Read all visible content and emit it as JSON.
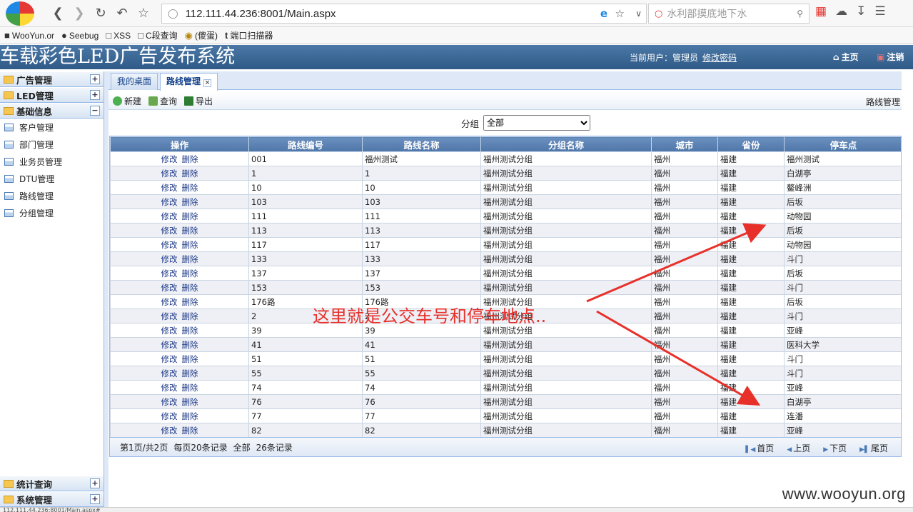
{
  "browser": {
    "url": "112.111.44.236:8001/Main.aspx",
    "search_placeholder": "水利部摸底地下水",
    "bookmarks": [
      "WooYun.or",
      "Seebug",
      "XSS",
      "C段查询",
      "(傻蛋)",
      "端口扫描器"
    ]
  },
  "header": {
    "title": "车载彩色LED广告发布系统",
    "current_user_label": "当前用户：管理员",
    "change_password": "修改密码",
    "home": "主页",
    "logout": "注销"
  },
  "sidebar": {
    "groups": [
      {
        "label": "广告管理",
        "toggle": "+"
      },
      {
        "label": "LED管理",
        "toggle": "+"
      },
      {
        "label": "基础信息",
        "toggle": "−"
      }
    ],
    "items": [
      "客户管理",
      "部门管理",
      "业务员管理",
      "DTU管理",
      "路线管理",
      "分组管理"
    ],
    "bottom_groups": [
      {
        "label": "统计查询",
        "toggle": "+"
      },
      {
        "label": "系统管理",
        "toggle": "+"
      }
    ]
  },
  "tabs": [
    {
      "label": "我的桌面"
    },
    {
      "label": "路线管理",
      "close": "×"
    }
  ],
  "toolbar": {
    "new": "新建",
    "query": "查询",
    "export": "导出",
    "title": "路线管理"
  },
  "filter": {
    "label": "分组",
    "selected": "全部"
  },
  "table": {
    "columns": [
      "操作",
      "路线编号",
      "路线名称",
      "分组名称",
      "城市",
      "省份",
      "停车点"
    ],
    "op_edit": "修改",
    "op_delete": "删除",
    "rows": [
      [
        "001",
        "福州测试",
        "福州测试分组",
        "福州",
        "福建",
        "福州测试"
      ],
      [
        "1",
        "1",
        "福州测试分组",
        "福州",
        "福建",
        "白湖亭"
      ],
      [
        "10",
        "10",
        "福州测试分组",
        "福州",
        "福建",
        "鳌峰洲"
      ],
      [
        "103",
        "103",
        "福州测试分组",
        "福州",
        "福建",
        "后坂"
      ],
      [
        "111",
        "111",
        "福州测试分组",
        "福州",
        "福建",
        "动物园"
      ],
      [
        "113",
        "113",
        "福州测试分组",
        "福州",
        "福建",
        "后坂"
      ],
      [
        "117",
        "117",
        "福州测试分组",
        "福州",
        "福建",
        "动物园"
      ],
      [
        "133",
        "133",
        "福州测试分组",
        "福州",
        "福建",
        "斗门"
      ],
      [
        "137",
        "137",
        "福州测试分组",
        "福州",
        "福建",
        "后坂"
      ],
      [
        "153",
        "153",
        "福州测试分组",
        "福州",
        "福建",
        "斗门"
      ],
      [
        "176路",
        "176路",
        "福州测试分组",
        "福州",
        "福建",
        "后坂"
      ],
      [
        "2",
        "2",
        "福州测试分组",
        "福州",
        "福建",
        "斗门"
      ],
      [
        "39",
        "39",
        "福州测试分组",
        "福州",
        "福建",
        "亚峰"
      ],
      [
        "41",
        "41",
        "福州测试分组",
        "福州",
        "福建",
        "医科大学"
      ],
      [
        "51",
        "51",
        "福州测试分组",
        "福州",
        "福建",
        "斗门"
      ],
      [
        "55",
        "55",
        "福州测试分组",
        "福州",
        "福建",
        "斗门"
      ],
      [
        "74",
        "74",
        "福州测试分组",
        "福州",
        "福建",
        "亚峰"
      ],
      [
        "76",
        "76",
        "福州测试分组",
        "福州",
        "福建",
        "白湖亭"
      ],
      [
        "77",
        "77",
        "福州测试分组",
        "福州",
        "福建",
        "连潘"
      ],
      [
        "82",
        "82",
        "福州测试分组",
        "福州",
        "福建",
        "亚峰"
      ]
    ]
  },
  "pager": {
    "page_info": "第1页/共2页",
    "per_page": "每页20条记录",
    "scope": "全部",
    "total": "26条记录",
    "first": "首页",
    "prev": "上页",
    "next": "下页",
    "last": "尾页"
  },
  "annotation": "这里就是公交车号和停车地点..",
  "watermark": "www.wooyun.org",
  "status_url": "112.111.44.236:8001/Main.aspx#",
  "colors": {
    "header": "#3d6897",
    "annotation": "#e8302a",
    "grid_header": "#5b82b4"
  }
}
